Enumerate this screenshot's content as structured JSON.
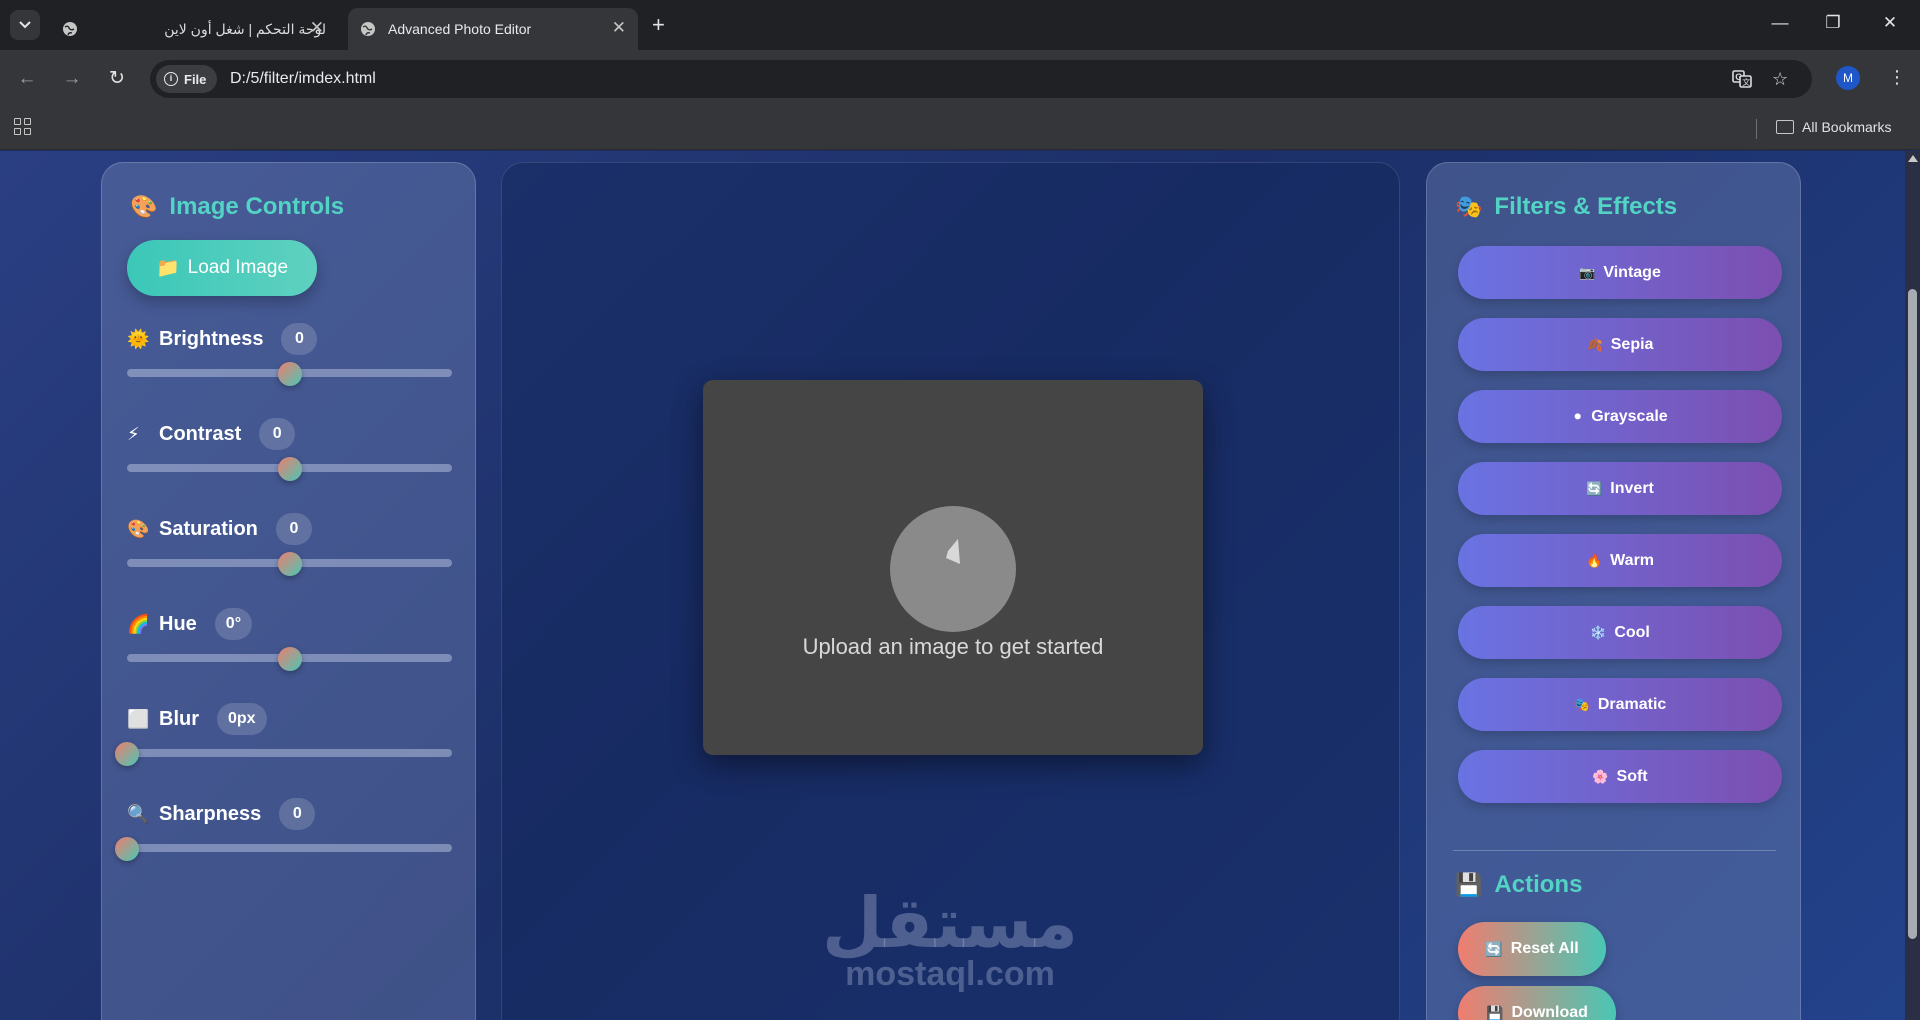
{
  "browser": {
    "tabs": [
      {
        "title": "لوحة التحكم | شغل أون لاين",
        "active": false
      },
      {
        "title": "Advanced Photo Editor",
        "active": true
      }
    ],
    "address_chip": "File",
    "url": "D:/5/filter/imdex.html",
    "profile_initial": "M",
    "bookmarks_label": "All Bookmarks"
  },
  "left_panel": {
    "title": "Image Controls",
    "title_icon": "🎨",
    "load_button": {
      "label": "Load Image",
      "icon": "📁"
    },
    "controls": [
      {
        "label": "Brightness",
        "icon": "🌞",
        "value": "0",
        "position": 0.5
      },
      {
        "label": "Contrast",
        "icon": "⚡",
        "value": "0",
        "position": 0.5
      },
      {
        "label": "Saturation",
        "icon": "🎨",
        "value": "0",
        "position": 0.5
      },
      {
        "label": "Hue",
        "icon": "🌈",
        "value": "0°",
        "position": 0.5
      },
      {
        "label": "Blur",
        "icon": "⬜",
        "value": "0px",
        "position": 0.0
      },
      {
        "label": "Sharpness",
        "icon": "🔍",
        "value": "0",
        "position": 0.0
      }
    ]
  },
  "canvas": {
    "placeholder_text": "Upload an image to get started"
  },
  "watermark": {
    "arabic": "مستقل",
    "latin": "mostaql.com"
  },
  "right_panel": {
    "title": "Filters & Effects",
    "title_icon": "🎭",
    "filters": [
      {
        "label": "Vintage",
        "icon": "📷"
      },
      {
        "label": "Sepia",
        "icon": "🍂"
      },
      {
        "label": "Grayscale",
        "icon": "⚫"
      },
      {
        "label": "Invert",
        "icon": "🔄"
      },
      {
        "label": "Warm",
        "icon": "🔥"
      },
      {
        "label": "Cool",
        "icon": "❄️"
      },
      {
        "label": "Dramatic",
        "icon": "🎭"
      },
      {
        "label": "Soft",
        "icon": "🌸"
      }
    ],
    "actions_title": "Actions",
    "actions_icon": "💾",
    "actions": [
      {
        "label": "Reset All",
        "icon": "🔄"
      },
      {
        "label": "Download",
        "icon": "💾"
      }
    ]
  },
  "colors": {
    "accent_teal": "#52d3c4",
    "filter_gradient_start": "#6a73e3",
    "filter_gradient_end": "#7c4fb0",
    "reset_gradient_start": "#f07d6f",
    "reset_gradient_end": "#49c7b5"
  }
}
